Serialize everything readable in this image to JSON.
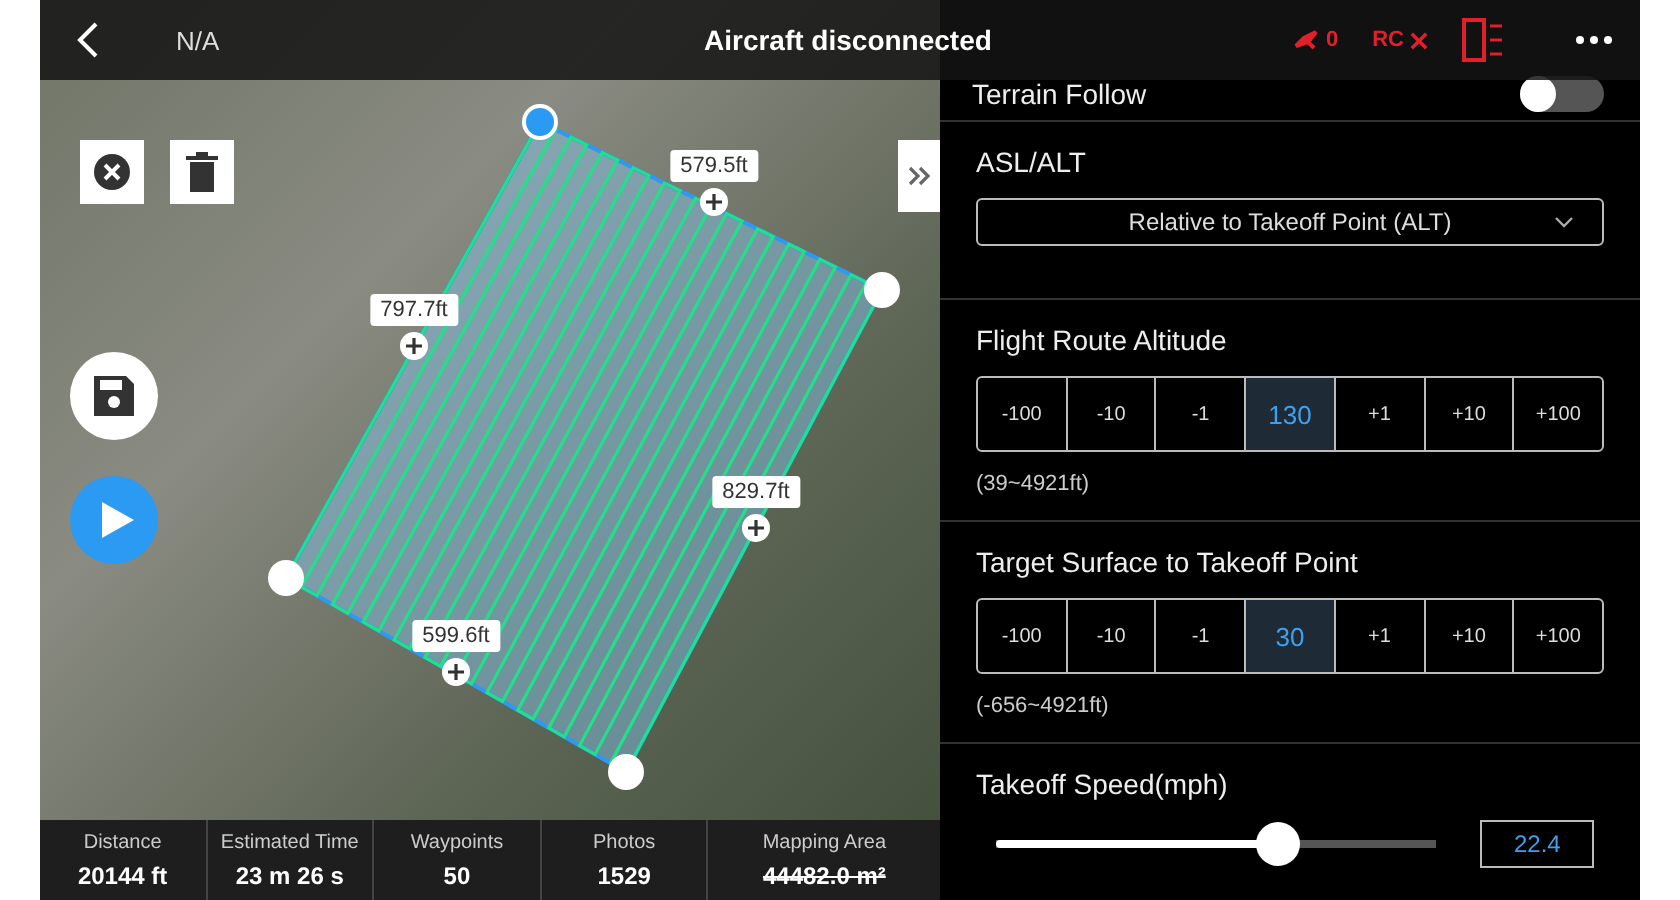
{
  "top_bar": {
    "signal": "N/A",
    "title": "Aircraft disconnected",
    "aircraft_count": "0",
    "rc_label": "RC"
  },
  "map": {
    "edge_labels": [
      {
        "text": "579.5ft"
      },
      {
        "text": "797.7ft"
      },
      {
        "text": "829.7ft"
      },
      {
        "text": "599.6ft"
      }
    ]
  },
  "stats": [
    {
      "label": "Distance",
      "value": "20144 ft",
      "struck": false
    },
    {
      "label": "Estimated Time",
      "value": "23 m 26 s",
      "struck": false
    },
    {
      "label": "Waypoints",
      "value": "50",
      "struck": false
    },
    {
      "label": "Photos",
      "value": "1529",
      "struck": false
    },
    {
      "label": "Mapping Area",
      "value": "44482.0 m²",
      "struck": true
    }
  ],
  "panel": {
    "terrain_follow": {
      "label": "Terrain Follow",
      "on": false
    },
    "asl_alt": {
      "label": "ASL/ALT",
      "value": "Relative to Takeoff Point (ALT)"
    },
    "steppers": [
      {
        "label": "Flight Route Altitude",
        "range": "(39~4921ft)",
        "cells": [
          {
            "text": "-100",
            "kind": "step"
          },
          {
            "text": "-10",
            "kind": "step"
          },
          {
            "text": "-1",
            "kind": "step"
          },
          {
            "text": "130",
            "kind": "value"
          },
          {
            "text": "+1",
            "kind": "step"
          },
          {
            "text": "+10",
            "kind": "step"
          },
          {
            "text": "+100",
            "kind": "step"
          }
        ]
      },
      {
        "label": "Target Surface to Takeoff Point",
        "range": "(-656~4921ft)",
        "cells": [
          {
            "text": "-100",
            "kind": "step"
          },
          {
            "text": "-10",
            "kind": "step"
          },
          {
            "text": "-1",
            "kind": "step"
          },
          {
            "text": "30",
            "kind": "value"
          },
          {
            "text": "+1",
            "kind": "step"
          },
          {
            "text": "+10",
            "kind": "step"
          },
          {
            "text": "+100",
            "kind": "step"
          }
        ]
      }
    ],
    "takeoff_speed": {
      "label": "Takeoff Speed(mph)",
      "level": 0.64,
      "value": "22.4"
    }
  }
}
